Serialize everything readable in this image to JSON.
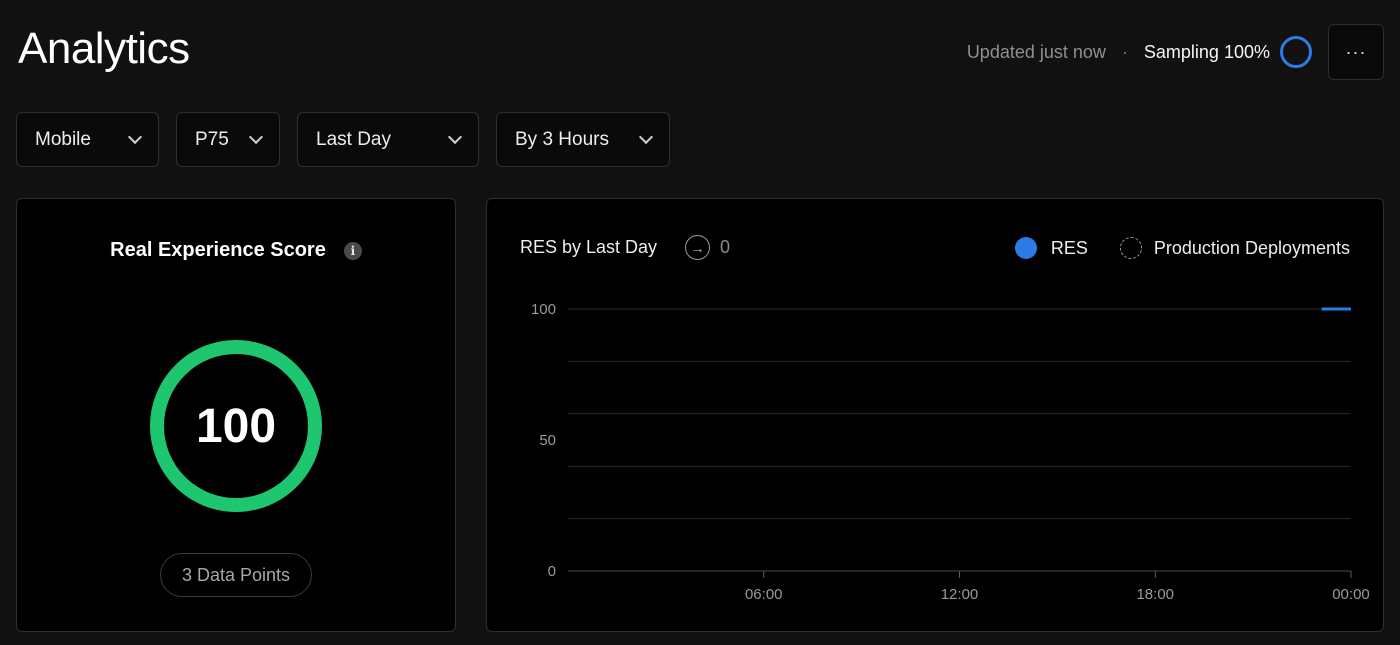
{
  "header": {
    "title": "Analytics",
    "updated": "Updated just now",
    "separator": "·",
    "sampling": "Sampling 100%",
    "more": "···"
  },
  "filters": [
    {
      "label": "Mobile"
    },
    {
      "label": "P75"
    },
    {
      "label": "Last Day"
    },
    {
      "label": "By 3 Hours"
    }
  ],
  "score_card": {
    "title": "Real Experience Score",
    "info": "i",
    "score": "100",
    "data_points": "3 Data Points",
    "gauge_color": "#1fc670"
  },
  "chart_card": {
    "title": "RES by Last Day",
    "deployments_count": "0",
    "legend": [
      {
        "name": "RES",
        "color": "#2c7be5"
      },
      {
        "name": "Production Deployments"
      }
    ]
  },
  "chart_data": {
    "type": "line",
    "series": [
      {
        "name": "RES",
        "color": "#2c7be5",
        "x": [
          23.1,
          24.0
        ],
        "values": [
          100,
          100
        ]
      }
    ],
    "xlim": [
      0,
      24
    ],
    "ylim": [
      0,
      100
    ],
    "y_ticks": [
      {
        "value": 0,
        "label": "0"
      },
      {
        "value": 50,
        "label": "50"
      },
      {
        "value": 100,
        "label": "100"
      }
    ],
    "x_ticks": [
      {
        "value": 6,
        "label": "06:00"
      },
      {
        "value": 12,
        "label": "12:00"
      },
      {
        "value": 18,
        "label": "18:00"
      },
      {
        "value": 24,
        "label": "00:00"
      }
    ],
    "gridlines": [
      0,
      20,
      40,
      60,
      80,
      100
    ],
    "grid": true
  }
}
